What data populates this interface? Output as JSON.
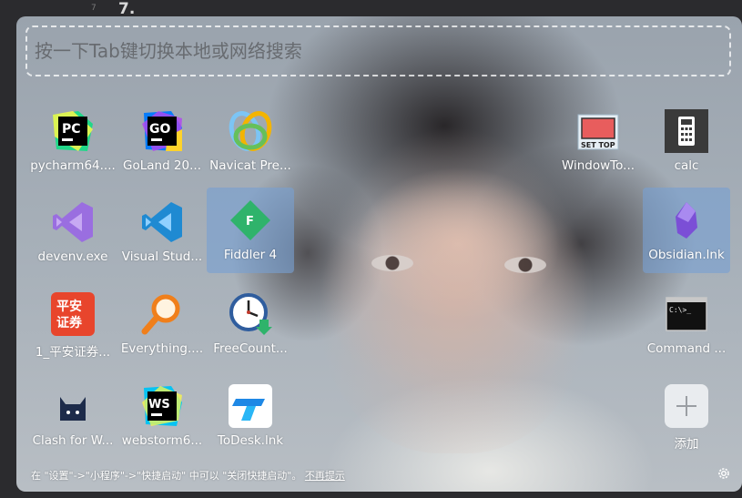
{
  "editor": {
    "line_number": "7",
    "heading": "7."
  },
  "search": {
    "placeholder": "按一下Tab键切换本地或网络搜索"
  },
  "apps": {
    "pycharm": "pycharm64....",
    "goland": "GoLand 20...",
    "navicat": "Navicat Pre...",
    "windowtop": "WindowTo...",
    "calc": "calc",
    "devenv": "devenv.exe",
    "vscode": "Visual Stud...",
    "fiddler": "Fiddler 4",
    "obsidian": "Obsidian.lnk",
    "pingan": "1_平安证券...",
    "everything": "Everything....",
    "freecount": "FreeCount...",
    "command": "Command ...",
    "clash": "Clash for W...",
    "webstorm": "webstorm6...",
    "todesk": "ToDesk.lnk",
    "add": "添加"
  },
  "icons": {
    "pycharm": "PC",
    "goland": "GO",
    "webstorm": "WS",
    "fiddler": "F",
    "pingan_line1": "平安",
    "pingan_line2": "证券",
    "settop": "SET TOP",
    "cmd_prompt": "C:\\>_"
  },
  "footer": {
    "tip": "在 \"设置\"->\"小程序\"->\"快捷启动\" 中可以 \"关闭快捷启动\"。",
    "dismiss": "不再提示"
  },
  "colors": {
    "selected_tile": "#78a0d2",
    "obsidian": "#7b4fd6",
    "vscode": "#1f8ad2",
    "fiddler": "#2fb36b",
    "pingan": "#e8452c"
  }
}
